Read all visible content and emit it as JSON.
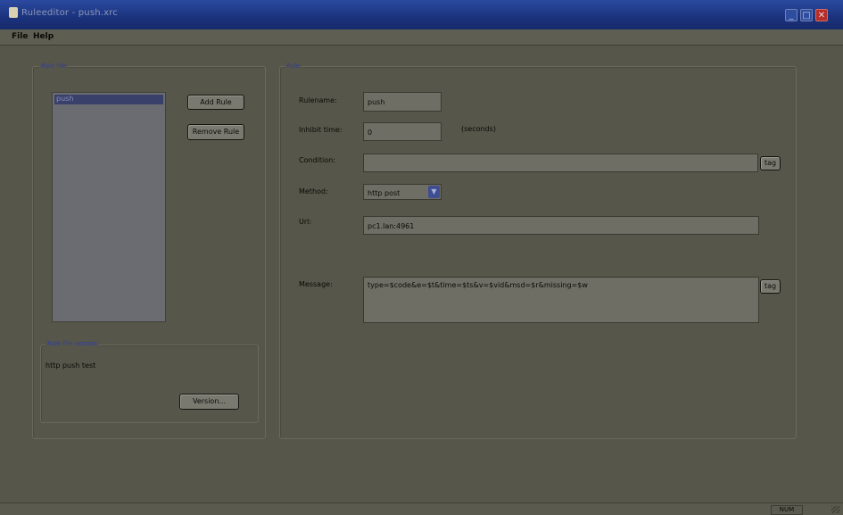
{
  "window": {
    "title": "Ruleeditor - push.xrc",
    "minimize_glyph": "_",
    "maximize_glyph": "□",
    "close_glyph": "✕"
  },
  "menu": [
    "File",
    "Help"
  ],
  "rule_file": {
    "legend": "Rule file",
    "items": [
      "push"
    ],
    "add_label": "Add Rule",
    "remove_label": "Remove Rule",
    "version_group": {
      "legend": "Rule file version",
      "text": "http push test",
      "button_label": "Version..."
    }
  },
  "rule": {
    "legend": "Rule",
    "rulename_label": "Rulename:",
    "rulename_value": "push",
    "inhibit_label": "Inhibit time:",
    "inhibit_value": "0",
    "inhibit_unit": "(seconds)",
    "condition_label": "Condition:",
    "condition_value": "",
    "condition_tag_label": "tag",
    "method_label": "Method:",
    "method_value": "http post",
    "url_label": "Url:",
    "url_value": "pc1.lan:4961",
    "message_label": "Message:",
    "message_value": "type=$code&e=$t&time=$ts&v=$vid&msd=$r&missing=$w",
    "message_tag_label": "tag"
  },
  "status": {
    "pane": "NUM"
  }
}
